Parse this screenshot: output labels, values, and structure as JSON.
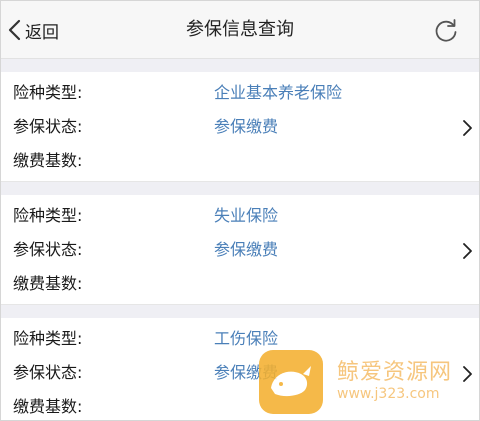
{
  "header": {
    "back_label": "返回",
    "title": "参保信息查询"
  },
  "labels": {
    "type": "险种类型:",
    "status": "参保状态:",
    "base": "缴费基数:"
  },
  "records": [
    {
      "type": "企业基本养老保险",
      "status": "参保缴费",
      "base": ""
    },
    {
      "type": "失业保险",
      "status": "参保缴费",
      "base": ""
    },
    {
      "type": "工伤保险",
      "status": "参保缴费",
      "base": ""
    }
  ],
  "watermark": {
    "name": "鲸爱资源网",
    "url": "www.j323.com"
  },
  "colors": {
    "value": "#4a7fb8",
    "background": "#efeff4",
    "watermark": "#f4b030"
  }
}
